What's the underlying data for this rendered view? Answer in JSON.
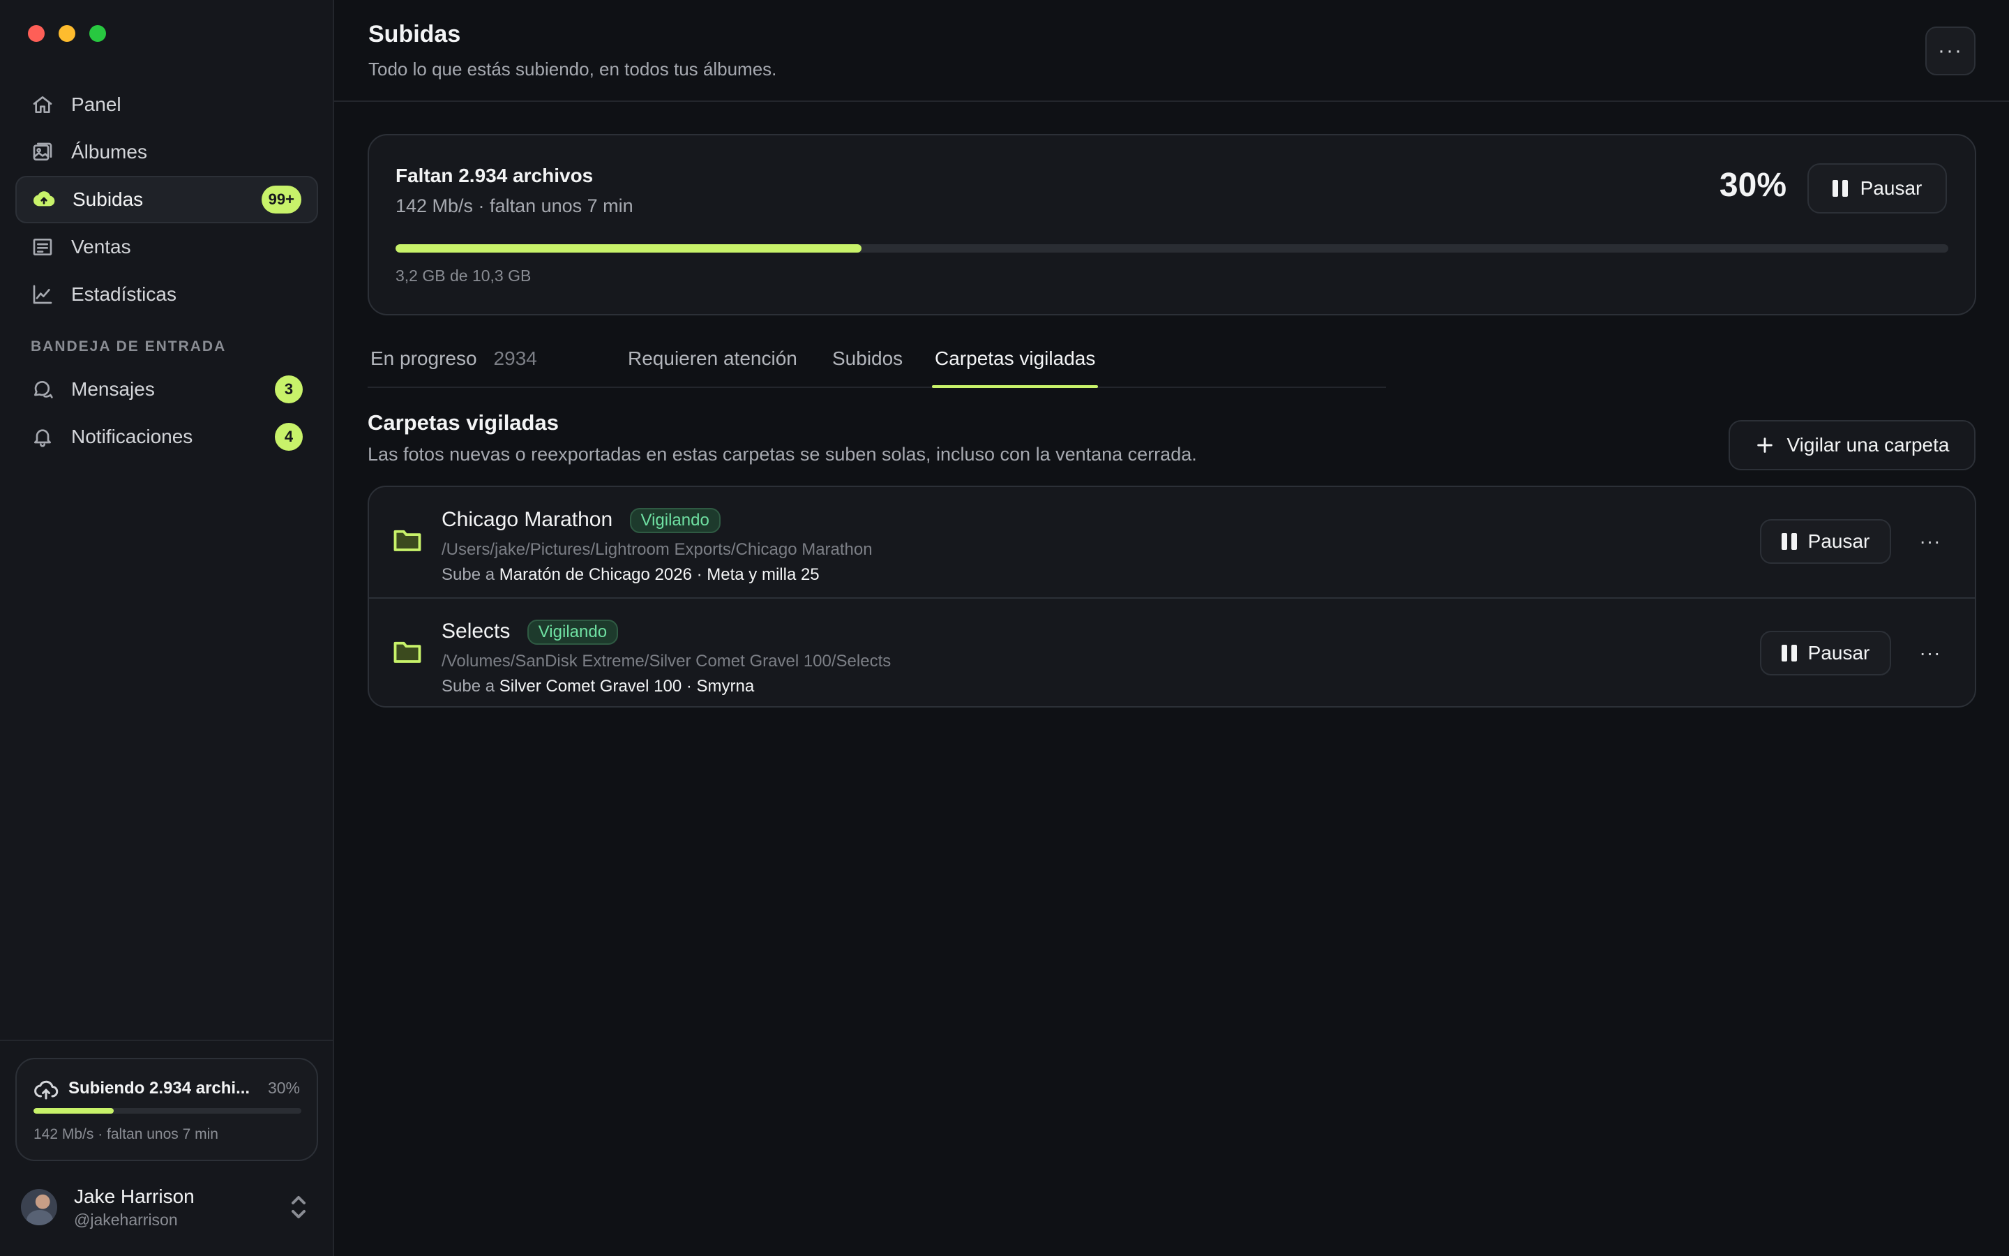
{
  "sidebar": {
    "nav": [
      {
        "label": "Panel",
        "icon": "home-icon"
      },
      {
        "label": "Álbumes",
        "icon": "image-icon"
      },
      {
        "label": "Subidas",
        "icon": "cloud-upload-icon",
        "badge": "99+",
        "active": true
      },
      {
        "label": "Ventas",
        "icon": "receipt-icon"
      },
      {
        "label": "Estadísticas",
        "icon": "chart-icon"
      }
    ],
    "inbox_heading": "BANDEJA DE ENTRADA",
    "inbox": [
      {
        "label": "Mensajes",
        "icon": "chat-icon",
        "badge": "3"
      },
      {
        "label": "Notificaciones",
        "icon": "bell-icon",
        "badge": "4"
      }
    ],
    "mini_upload": {
      "title": "Subiendo 2.934 archi...",
      "percent_label": "30%",
      "progress": 0.3,
      "subtitle": "142 Mb/s · faltan unos 7 min"
    },
    "user": {
      "name": "Jake Harrison",
      "handle": "@jakeharrison"
    }
  },
  "header": {
    "title": "Subidas",
    "subtitle": "Todo lo que estás subiendo, en todos tus álbumes.",
    "more_label": "···"
  },
  "progress": {
    "title": "Faltan 2.934 archivos",
    "subtitle": "142 Mb/s · faltan unos 7 min",
    "percent_label": "30%",
    "progress": 0.3,
    "pause_label": "Pausar",
    "size_label": "3,2 GB de 10,3 GB"
  },
  "tabs": [
    {
      "label": "En progreso",
      "count": "2934"
    },
    {
      "label": "Requieren atención"
    },
    {
      "label": "Subidos"
    },
    {
      "label": "Carpetas vigiladas",
      "active": true
    }
  ],
  "watched": {
    "title": "Carpetas vigiladas",
    "subtitle": "Las fotos nuevas o reexportadas en estas carpetas se suben solas, incluso con la ventana cerrada.",
    "add_label": "Vigilar una carpeta",
    "folders": [
      {
        "name": "Chicago Marathon",
        "status": "Vigilando",
        "path": "/Users/jake/Pictures/Lightroom Exports/Chicago Marathon",
        "dest_prefix": "Sube a",
        "dest": "Maratón de Chicago 2026 · Meta y milla 25",
        "pause_label": "Pausar",
        "more_label": "···"
      },
      {
        "name": "Selects",
        "status": "Vigilando",
        "path": "/Volumes/SanDisk Extreme/Silver Comet Gravel 100/Selects",
        "dest_prefix": "Sube a",
        "dest": "Silver Comet Gravel 100 · Smyrna",
        "pause_label": "Pausar",
        "more_label": "···"
      }
    ]
  },
  "colors": {
    "accent": "#c8f26a",
    "status_green": "#6fe0a2",
    "background": "#0f1115"
  }
}
